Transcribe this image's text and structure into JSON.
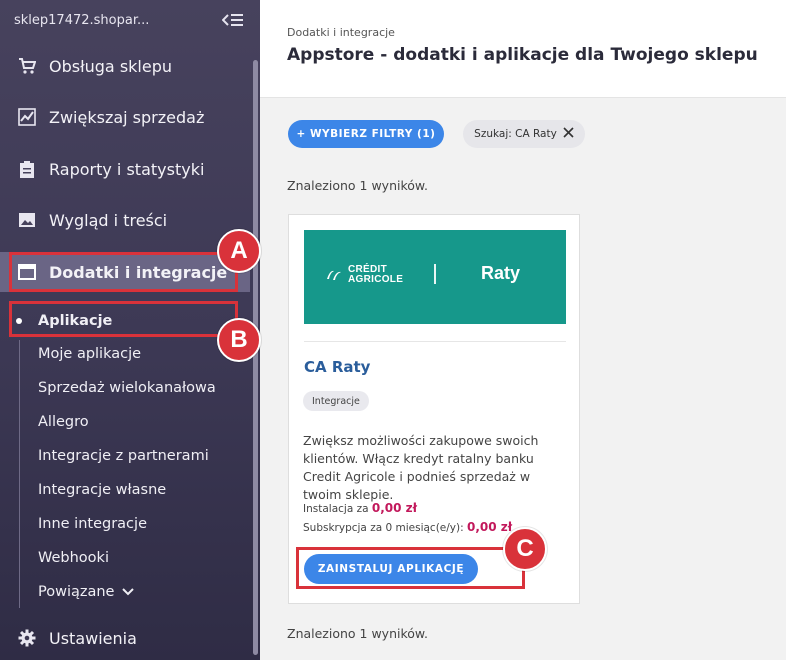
{
  "sidebar": {
    "shop_name": "sklep17472.shopar...",
    "items": [
      {
        "label": "Obsługa sklepu",
        "icon": "cart-icon"
      },
      {
        "label": "Zwiększaj sprzedaż",
        "icon": "chart-icon"
      },
      {
        "label": "Raporty i statystyki",
        "icon": "clipboard-icon"
      },
      {
        "label": "Wygląd i treści",
        "icon": "image-icon"
      },
      {
        "label": "Dodatki i integracje",
        "icon": "window-icon"
      }
    ],
    "subitems": [
      {
        "label": "Aplikacje"
      },
      {
        "label": "Moje aplikacje"
      },
      {
        "label": "Sprzedaż wielokanałowa"
      },
      {
        "label": "Allegro"
      },
      {
        "label": "Integracje z partnerami"
      },
      {
        "label": "Integracje własne"
      },
      {
        "label": "Inne integracje"
      },
      {
        "label": "Webhooki"
      },
      {
        "label": "Powiązane"
      }
    ],
    "settings": {
      "label": "Ustawienia",
      "icon": "gear-icon"
    }
  },
  "callouts": {
    "a": "A",
    "b": "B",
    "c": "C"
  },
  "header": {
    "breadcrumb": "Dodatki i integracje",
    "title": "Appstore - dodatki i aplikacje dla Twojego sklepu"
  },
  "filters": {
    "button_label": "+ WYBIERZ FILTRY (1)",
    "chip_label": "Szukaj: CA Raty"
  },
  "results_text": "Znaleziono 1 wyników.",
  "app": {
    "banner_brand": [
      "CRÉDIT",
      "AGRICOLE"
    ],
    "banner_product": "Raty",
    "name": "CA Raty",
    "tag": "Integracje",
    "description": "Zwiększ możliwości zakupowe swoich klientów. Włącz kredyt ratalny banku Credit Agricole i podnieś sprzedaż w twoim sklepie.",
    "install_label": "Instalacja za",
    "install_price": "0,00 zł",
    "subscription_label": "Subskrypcja za 0 miesiąc(e/y):",
    "subscription_price": "0,00 zł",
    "install_button": "ZAINSTALUJ APLIKACJĘ"
  },
  "colors": {
    "accent": "#3c86e8",
    "highlight": "#d9323a",
    "banner": "#16988b",
    "price": "#c2185b"
  }
}
